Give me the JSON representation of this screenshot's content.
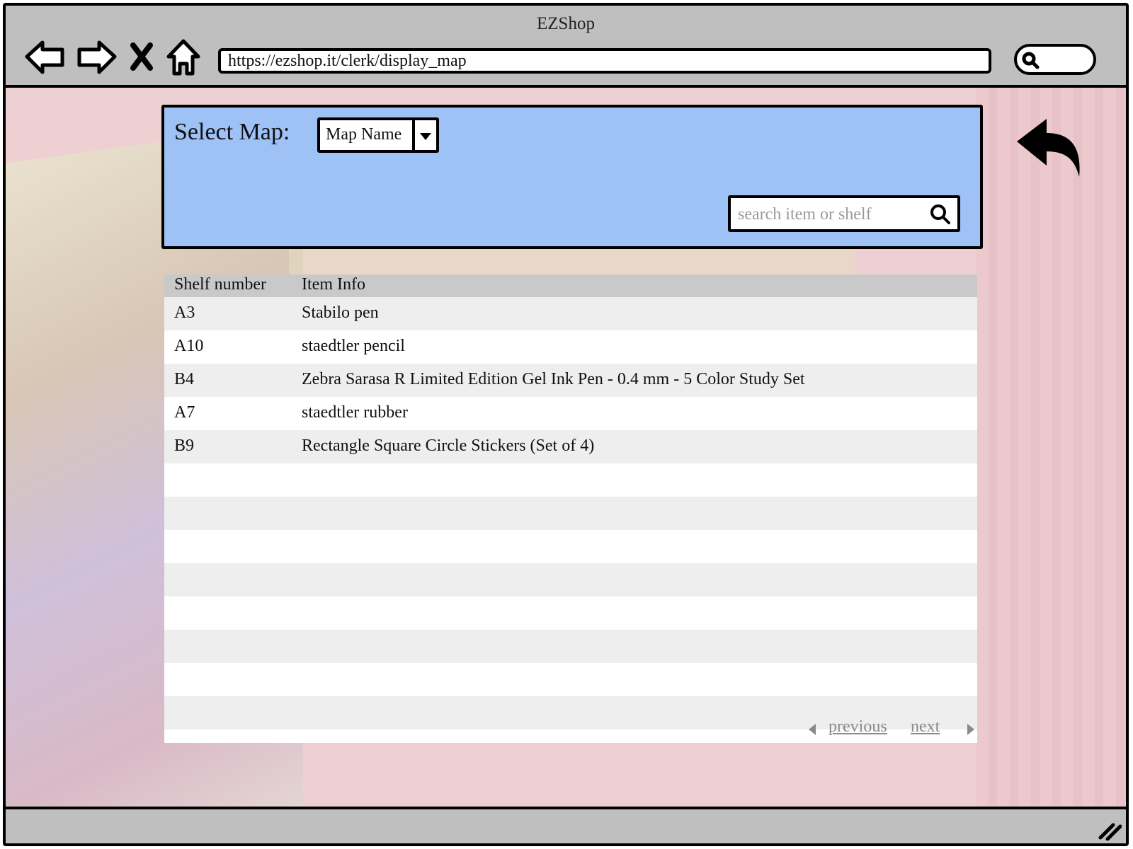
{
  "window": {
    "title": "EZShop"
  },
  "browser": {
    "url": "https://ezshop.it/clerk/display_map",
    "icons": [
      "back-arrow-icon",
      "forward-arrow-icon",
      "stop-x-icon",
      "home-icon",
      "search-icon"
    ]
  },
  "panel": {
    "select_label": "Select Map:",
    "map_select_value": "Map Name",
    "search_placeholder": "search item or shelf",
    "panel_color": "#9ec1f6"
  },
  "table": {
    "headers": {
      "shelf": "Shelf number",
      "item": "Item Info"
    },
    "rows": [
      {
        "shelf": "A3",
        "item": "Stabilo pen"
      },
      {
        "shelf": "A10",
        "item": "staedtler pencil"
      },
      {
        "shelf": "B4",
        "item": "Zebra Sarasa R Limited Edition Gel Ink Pen - 0.4 mm - 5 Color Study Set"
      },
      {
        "shelf": "A7",
        "item": "staedtler rubber"
      },
      {
        "shelf": "B9",
        "item": "Rectangle Square Circle Stickers (Set of 4)"
      }
    ]
  },
  "pager": {
    "previous": "previous",
    "next": "next"
  }
}
